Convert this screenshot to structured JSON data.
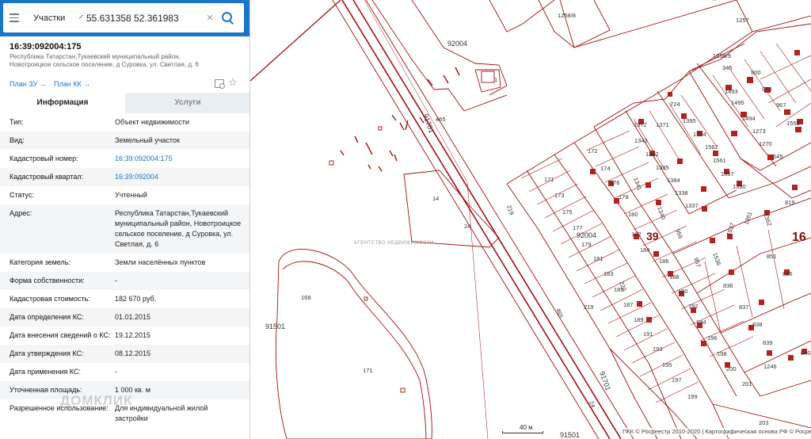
{
  "search": {
    "type_label": "Участки",
    "query": "55.631358 52.361983",
    "clear_icon": "×"
  },
  "card": {
    "cadastral_number": "16:39:092004:175",
    "address_short": "Республика Татарстан,Тукаевский муниципальный район, Новотроицкое сельское поселение, д Суровка, ул. Светлая, д. 6",
    "plan_zu": "План ЗУ →",
    "plan_kk": "План КК →"
  },
  "tabs": [
    {
      "label": "Информация",
      "active": true
    },
    {
      "label": "Услуги",
      "active": false
    }
  ],
  "rows": [
    {
      "key": "Тип:",
      "value": "Объект недвижимости",
      "link": false
    },
    {
      "key": "Вид:",
      "value": "Земельный участок",
      "link": false
    },
    {
      "key": "Кадастровый номер:",
      "value": "16:39:092004:175",
      "link": true
    },
    {
      "key": "Кадастровый квартал:",
      "value": "16:39:092004",
      "link": true
    },
    {
      "key": "Статус:",
      "value": "Учтенный",
      "link": false
    },
    {
      "key": "Адрес:",
      "value": "Республика Татарстан,Тукаевский муниципальный район, Новотроицкое сельское поселение, д Суровка, ул. Светлая, д. 6",
      "link": false
    },
    {
      "key": "Категория земель:",
      "value": "Земли населённых пунктов",
      "link": false
    },
    {
      "key": "Форма собственности:",
      "value": "-",
      "link": false
    },
    {
      "key": "Кадастровая стоимость:",
      "value": "182 670 руб.",
      "link": false
    },
    {
      "key": "Дата определения КС:",
      "value": "01.01.2015",
      "link": false
    },
    {
      "key": "Дата внесения сведений о КС:",
      "value": "19.12.2015",
      "link": false
    },
    {
      "key": "Дата утверждения КС:",
      "value": "08.12.2015",
      "link": false
    },
    {
      "key": "Дата применения КС:",
      "value": "-",
      "link": false
    },
    {
      "key": "Уточненная площадь:",
      "value": "1 000 кв. м",
      "link": false
    },
    {
      "key": "Разрешенное использование:",
      "value": "Для индивидуальной жилой застройки",
      "link": false
    }
  ],
  "watermark": {
    "domklik": "ДОМКЛИК",
    "logo_sub": "АГЕНТСТВО НЕДВИЖИМОСТИ"
  },
  "map": {
    "scale": "40 м",
    "copyright": "ПКК © Росреестр 2010-2020 | Картографическая основа РФ © Росреестр",
    "labels": {
      "q92004_top": "92004",
      "q92004_mid": "92004",
      "q91701_a": "91701",
      "q91701_b": "91701",
      "q91501_a": "91501",
      "q91501_b": "91501",
      "q39": "39",
      "q16": "16",
      "p1258_8": "1258/8",
      "p1257": "1257",
      "p1258_9": "1258/9",
      "p345": "345",
      "p900": "900",
      "p724": "724",
      "p1493": "1493",
      "p1495": "1495",
      "p970": "970",
      "p967": "967",
      "p1372": "1372",
      "p1371": "1371",
      "p1343": "1343",
      "p1342": "1342",
      "p1395": "1395",
      "p1594": "1594",
      "p1494": "1494",
      "p1555": "1555",
      "p1273": "1273",
      "p1270": "1270",
      "p545": "545",
      "p1385": "1385",
      "p1562": "1562",
      "p1561": "1561",
      "p1384": "1384",
      "p1557": "1557",
      "p1338": "1338",
      "p1390": "1390",
      "p1337": "1337",
      "p172": "172",
      "p174": "174",
      "p171": "171",
      "p176": "176",
      "p173": "173",
      "p178": "178",
      "p175": "175",
      "p180": "180",
      "p177": "177",
      "p182": "182",
      "p179": "179",
      "p184": "184",
      "p181": "181",
      "p186": "186",
      "p183": "183",
      "p188": "188",
      "p185": "185",
      "p190": "190",
      "p187": "187",
      "p192": "192",
      "p189": "189",
      "p194": "194",
      "p191": "191",
      "p196": "196",
      "p193": "193",
      "p198": "198",
      "p195": "195",
      "p200": "200",
      "p197": "197",
      "p201": "201",
      "p199": "199",
      "p203": "203",
      "p219a": "219",
      "p219b": "219",
      "p220": "220",
      "p465a": "465",
      "p465b": "465",
      "p14": "14",
      "p24a": "24",
      "p24b": "24",
      "p168": "168",
      "p171b": "171",
      "p1341": "1341",
      "p1340": "1340",
      "p956": "956",
      "p957": "957",
      "p1537": "1537",
      "p1536": "1536",
      "p1362": "1362",
      "p1361": "1361",
      "p819": "819",
      "p851": "851",
      "p826": "826",
      "p836": "836",
      "p837": "837",
      "p838": "838",
      "p839": "839",
      "p840": "840",
      "p1246": "1246",
      "p1": "1"
    }
  },
  "colors": {
    "accent": "#1a76c7",
    "parcel_line": "#a01010",
    "building": "#b22222"
  }
}
